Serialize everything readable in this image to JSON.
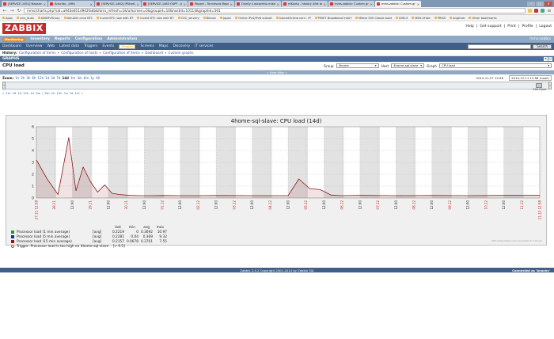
{
  "browser": {
    "tabs": [
      {
        "label": "[SERVICE-1451] Nasazeni O.."
      },
      {
        "label": "Anscilbj - jitRA"
      },
      {
        "label": "[SERVICE-1482] IPStartUPIR"
      },
      {
        "label": "[SERVICE-1483 OSPF - jiRA"
      },
      {
        "label": "Report - Tornstvoiz Report"
      },
      {
        "label": "Ovinty s autoreklu mikatk"
      },
      {
        "label": "mKonto - historý účet bez..."
      },
      {
        "label": "mms.zabbix: Custom graph.."
      },
      {
        "label": "mms.zabbix: Custom graph",
        "active": true
      }
    ],
    "url": "mms/charts.php?sid=a943e811d942fadb&form_refresh=1&fullscreen=0&groupid=10&hostid=10114&graphid=561",
    "bookmarks": [
      "Apps",
      "cms_eLab",
      "ANSMVIS.kay",
      "Aktuální cena BTC",
      "Invest BTC now with BT",
      "Invest BTC now with BT",
      "CHC_servery",
      "Bitcoin",
      "Japan",
      "Online IPv4/IPv6 subnet",
      "SubnetOnline.com - IP",
      "PMSIT Broadband Interf",
      "Mifare S50 Classic boot",
      "DVB-S",
      "MIDI.UHart",
      "PRISS",
      "Angthub",
      "Other bookmarks"
    ]
  },
  "zabbix": {
    "logo": "ZABBIX",
    "top_links": [
      "Help",
      "|",
      "Get support",
      "|",
      "Print",
      "|",
      "Profile",
      "|",
      "Logout"
    ],
    "main_menu": [
      "Monitoring",
      "Inventory",
      "Reports",
      "Configuration",
      "Administration"
    ],
    "main_menu_active": 0,
    "main_menu_right": "mms-zabbix",
    "sub_menu": [
      "Dashboard",
      "Overview",
      "Web",
      "Latest data",
      "Triggers",
      "Events",
      "Graphs",
      "Screens",
      "Maps",
      "Discovery",
      "IT services"
    ],
    "sub_menu_active": 6,
    "search_button": "Search",
    "history_label": "History:",
    "history": [
      "Configuration of items",
      "»",
      "Configuration of hosts",
      "»",
      "Configuration of items",
      "»",
      "Dashboard",
      "»",
      "Custom graphs"
    ],
    "section": "GRAPHS",
    "page_title": "CPU load",
    "group_label": "Group",
    "group_value": "4home",
    "host_label": "Host",
    "host_value": "4home-sql-slave",
    "graph_label": "Graph",
    "graph_value": "CPU load",
    "filter_label": "« Hide filter »",
    "zoom_label": "Zoom:",
    "zoom_options": [
      "1h",
      "2h",
      "3h",
      "6h",
      "12h",
      "1d",
      "3d",
      "7d",
      "14d",
      "1m",
      "3m",
      "6m",
      "1y",
      "All"
    ],
    "zoom_current": 8,
    "steps": [
      "«",
      "1m",
      "7d",
      "1d",
      "12h",
      "1h",
      "5m",
      "|",
      "5m",
      "1h",
      "12h",
      "1d",
      "7d",
      "1m",
      "»"
    ],
    "date_from": "2014-11-27 12:58",
    "sep": "-",
    "date_to": "2014-12-11 12:58 (now!)",
    "timeline_value": "14d",
    "timeline_fixed": "fixed"
  },
  "chart_data": {
    "type": "line",
    "title": "4home-sql-slave: CPU load (14d)",
    "ylim": [
      0,
      6
    ],
    "yticks": [
      "0",
      "1",
      "2",
      "3",
      "4",
      "5",
      "6"
    ],
    "x_ticks": [
      "27.11 12:58",
      "28.11",
      "12:00",
      "29.11",
      "12:00",
      "30.11",
      "12:00",
      "01.12",
      "12:00",
      "02.12",
      "12:00",
      "03.12",
      "12:00",
      "04.12",
      "12:00",
      "05.12",
      "12:00",
      "06.12",
      "12:00",
      "07.12",
      "12:00",
      "08.12",
      "12:00",
      "09.12",
      "12:00",
      "10.12",
      "12:00",
      "11.12",
      "11.12 12:58"
    ],
    "series": [
      {
        "name": "Processor load (1 min average)",
        "color": "#1a9e2a",
        "agg": "[avg]",
        "last": "0.2219",
        "min": "0",
        "avg": "0.3692",
        "max": "10.97"
      },
      {
        "name": "Processor load (5 min average)",
        "color": "#1a2ea0",
        "agg": "[avg]",
        "last": "0.2281",
        "min": "0.04",
        "avg": "0.369",
        "max": "9.32"
      },
      {
        "name": "Processor load (15 min average)",
        "color": "#8c1a1a",
        "agg": "[avg]",
        "last": "0.2157",
        "min": "0.0678",
        "avg": "0.3701",
        "max": "7.55"
      }
    ],
    "line": {
      "x": [
        0,
        0.3,
        0.6,
        0.9,
        1.1,
        1.3,
        1.5,
        1.7,
        1.9,
        2.1,
        2.3,
        2.6,
        2.9,
        3.2,
        3.5,
        4,
        4.5,
        5,
        6,
        7,
        7.3,
        7.6,
        7.9,
        8.2,
        8.5,
        9,
        10,
        11,
        12,
        13,
        14
      ],
      "y": [
        3.2,
        1.6,
        0.3,
        5.1,
        0.6,
        2.6,
        1.4,
        0.5,
        1.1,
        0.4,
        0.3,
        0.22,
        0.2,
        0.2,
        0.21,
        0.2,
        0.2,
        0.21,
        0.2,
        0.2,
        1.6,
        0.8,
        0.7,
        0.25,
        0.2,
        0.22,
        0.2,
        0.21,
        0.2,
        0.22,
        0.22
      ]
    },
    "legend_header": [
      "last",
      "min",
      "avg",
      "max"
    ],
    "trigger": {
      "label": "Trigger: Processor load is too high on 4home-sql-slave",
      "value": "[> 9.5]"
    },
    "watermark": "http://www.zabbix.com  Generated in 0.03 sec"
  },
  "footer": {
    "copyright": "Zabbix 2.4.2 Copyright 2001-2014 by Zabbix SIA",
    "connected": "Connected as 'bnachy'"
  }
}
